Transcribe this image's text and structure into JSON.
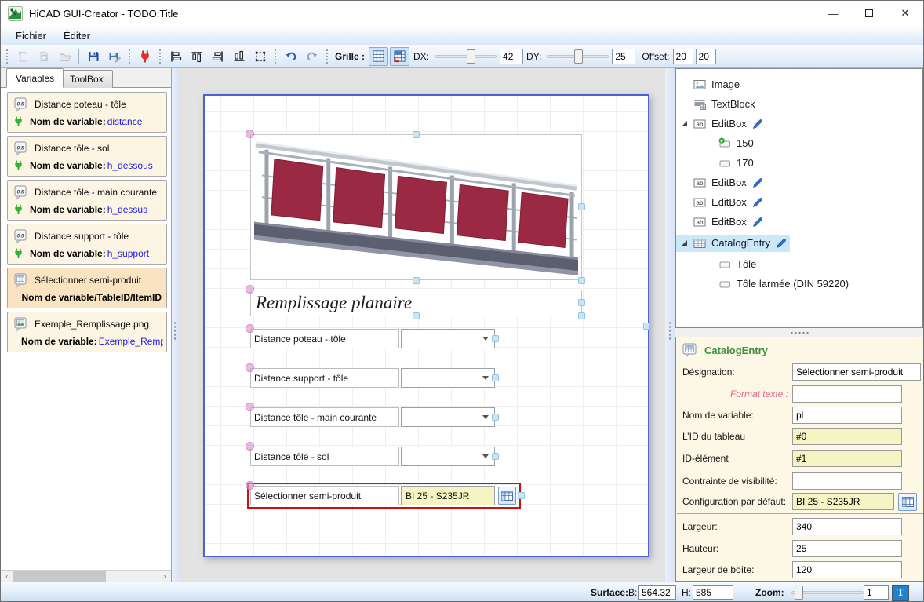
{
  "window": {
    "title": "HiCAD GUI-Creator - TODO:Title",
    "minimize_glyph": "—",
    "maximize_glyph": "□",
    "close_glyph": "✕"
  },
  "menu": {
    "fichier": "Fichier",
    "editer": "Éditer"
  },
  "toolbar": {
    "grille_label": "Grille :",
    "dx_label": "DX:",
    "dx_value": "42",
    "dy_label": "DY:",
    "dy_value": "25",
    "offset_label": "Offset:",
    "offset_x": "20",
    "offset_y": "20"
  },
  "left_panel": {
    "tab_variables": "Variables",
    "tab_toolbox": "ToolBox",
    "items": [
      {
        "title": "Distance poteau - tôle",
        "meta_label": "Nom de variable:",
        "meta_value": "distance"
      },
      {
        "title": "Distance tôle - sol",
        "meta_label": "Nom de variable:",
        "meta_value": "h_dessous"
      },
      {
        "title": "Distance tôle - main courante",
        "meta_label": "Nom de variable:",
        "meta_value": "h_dessus"
      },
      {
        "title": "Distance support - tôle",
        "meta_label": "Nom de variable:",
        "meta_value": "h_support"
      },
      {
        "title": "Sélectionner semi-produit",
        "meta_label": "Nom de variable/TableID/ItemID",
        "meta_value": ""
      },
      {
        "title": "Exemple_Remplissage.png",
        "meta_label": "Nom de variable:",
        "meta_value": "Exemple_Remp"
      }
    ]
  },
  "canvas": {
    "form_title": "Remplissage planaire",
    "rows": [
      {
        "label": "Distance poteau - tôle"
      },
      {
        "label": "Distance support - tôle"
      },
      {
        "label": "Distance tôle - main courante"
      },
      {
        "label": "Distance tôle - sol"
      }
    ],
    "catalog_row": {
      "label": "Sélectionner semi-produit",
      "value": "BI 25 - S235JR"
    }
  },
  "tree": {
    "items": [
      {
        "label": "Image"
      },
      {
        "label": "TextBlock"
      },
      {
        "label": "EditBox"
      },
      {
        "label": "150"
      },
      {
        "label": "170"
      },
      {
        "label": "EditBox"
      },
      {
        "label": "EditBox"
      },
      {
        "label": "EditBox"
      },
      {
        "label": "CatalogEntry"
      },
      {
        "label": "Tôle"
      },
      {
        "label": "Tôle larmée (DIN 59220)"
      }
    ]
  },
  "properties": {
    "header": "CatalogEntry",
    "designation_label": "Désignation:",
    "designation_value": "Sélectionner semi-produit",
    "format_label": "Format texte :",
    "format_value": "",
    "variable_label": "Nom de variable:",
    "variable_value": "pl",
    "tableid_label": "L’ID du tableau",
    "tableid_value": "#0",
    "itemid_label": "ID-élément",
    "itemid_value": "#1",
    "visibility_label": "Contrainte de visibilité:",
    "visibility_value": "",
    "config_label": "Configuration par défaut:",
    "config_value": "BI 25 - S235JR",
    "width_label": "Largeur:",
    "width_value": "340",
    "height_label": "Hauteur:",
    "height_value": "25",
    "boxwidth_label": "Largeur de boîte:",
    "boxwidth_value": "120"
  },
  "statusbar": {
    "surface_label": "Surface:",
    "b_label": "B:",
    "b_value": "564.32",
    "h_label": "H:",
    "h_value": "585",
    "zoom_label": "Zoom:",
    "zoom_value": "1",
    "t_button": "T"
  },
  "colors": {
    "page_border_blue": "#4A63D0",
    "selection_red": "#CC1111",
    "item_bg": "#FDF5E3",
    "item_selected_bg": "#FAE3C1",
    "props_bg": "#FCF8E5",
    "field_yellow": "#F5F4C3",
    "tree_selection": "#CBE8F8",
    "variable_text": "#1A1AE6",
    "header_green": "#3F8F3F",
    "pink_label": "#E06690",
    "panel_red": "#9B2944"
  }
}
